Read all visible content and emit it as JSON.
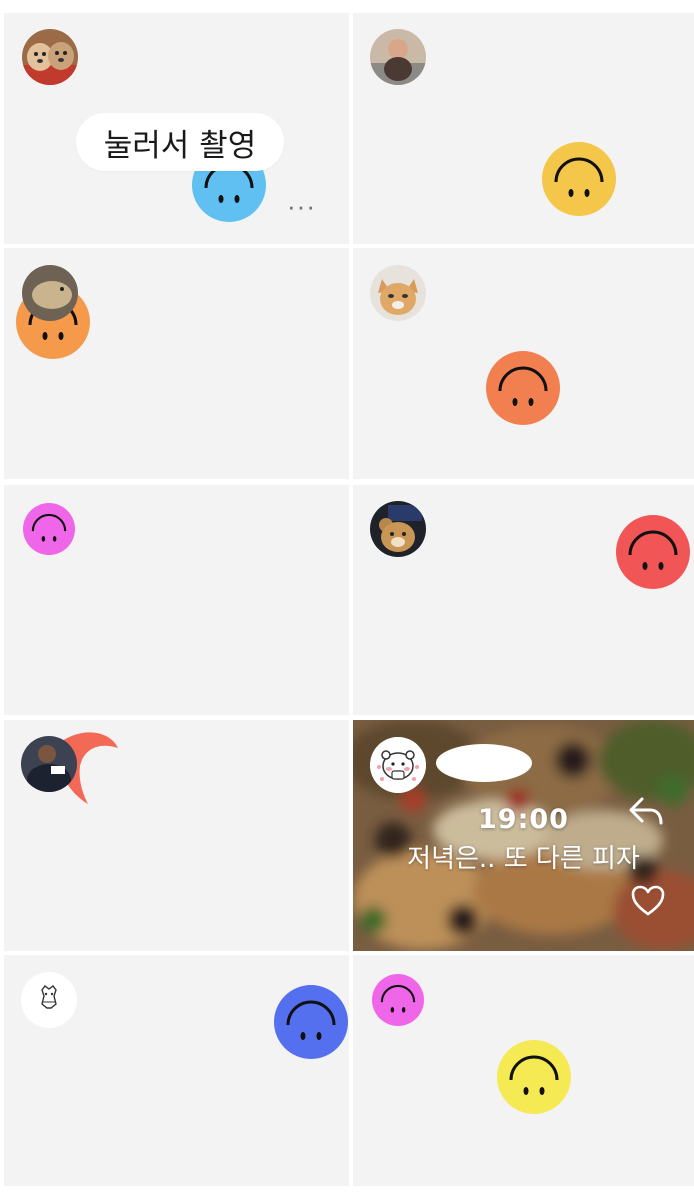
{
  "colors": {
    "cell_background": "#f3f3f4",
    "grid_gap": "#ffffff",
    "smiley_blue": "#5fc0f1",
    "smiley_yellow": "#f4c64a",
    "smiley_orange": "#f49a4a",
    "smiley_coral": "#f27f4f",
    "smiley_pink": "#ef67e8",
    "smiley_red": "#f25555",
    "smiley_partial_red": "#f26a55",
    "smiley_royal_blue": "#5470ef",
    "smiley_bright_yellow": "#f5ea53",
    "smiley_features": "#111111"
  },
  "grid": {
    "cells": [
      {
        "name": "photo-cell-1",
        "avatar": "dog-avatar",
        "reaction": "smiley-blue",
        "bubble": "눌러서 촬영",
        "more": "···"
      },
      {
        "name": "photo-cell-2",
        "avatar": "child-avatar",
        "reaction": "smiley-yellow"
      },
      {
        "name": "photo-cell-3",
        "avatar": "animal-avatar",
        "reaction": "smiley-orange"
      },
      {
        "name": "photo-cell-4",
        "avatar": "cat-avatar",
        "reaction": "smiley-coral"
      },
      {
        "name": "photo-cell-5",
        "avatar": "smiley-pink",
        "reaction": ""
      },
      {
        "name": "photo-cell-6",
        "avatar": "bear-avatar",
        "reaction": "smiley-red"
      },
      {
        "name": "photo-cell-7",
        "avatar": "person-avatar",
        "reaction": "smiley-partial-red"
      },
      {
        "name": "photo-cell-8",
        "avatar": "hamster-avatar",
        "time": "19:00",
        "caption": "저녁은.. 또 다른 피자",
        "icons": [
          "reply-icon",
          "heart-icon"
        ]
      },
      {
        "name": "photo-cell-9",
        "avatar": "sketch-avatar",
        "reaction": "smiley-royal-blue"
      },
      {
        "name": "photo-cell-10",
        "avatar": "smiley-pink-small",
        "reaction": "smiley-bright-yellow"
      }
    ]
  },
  "post": {
    "time": "19:00",
    "caption": "저녁은.. 또 다른 피자"
  },
  "bubble": {
    "label": "눌러서 촬영"
  },
  "more_label": "···"
}
